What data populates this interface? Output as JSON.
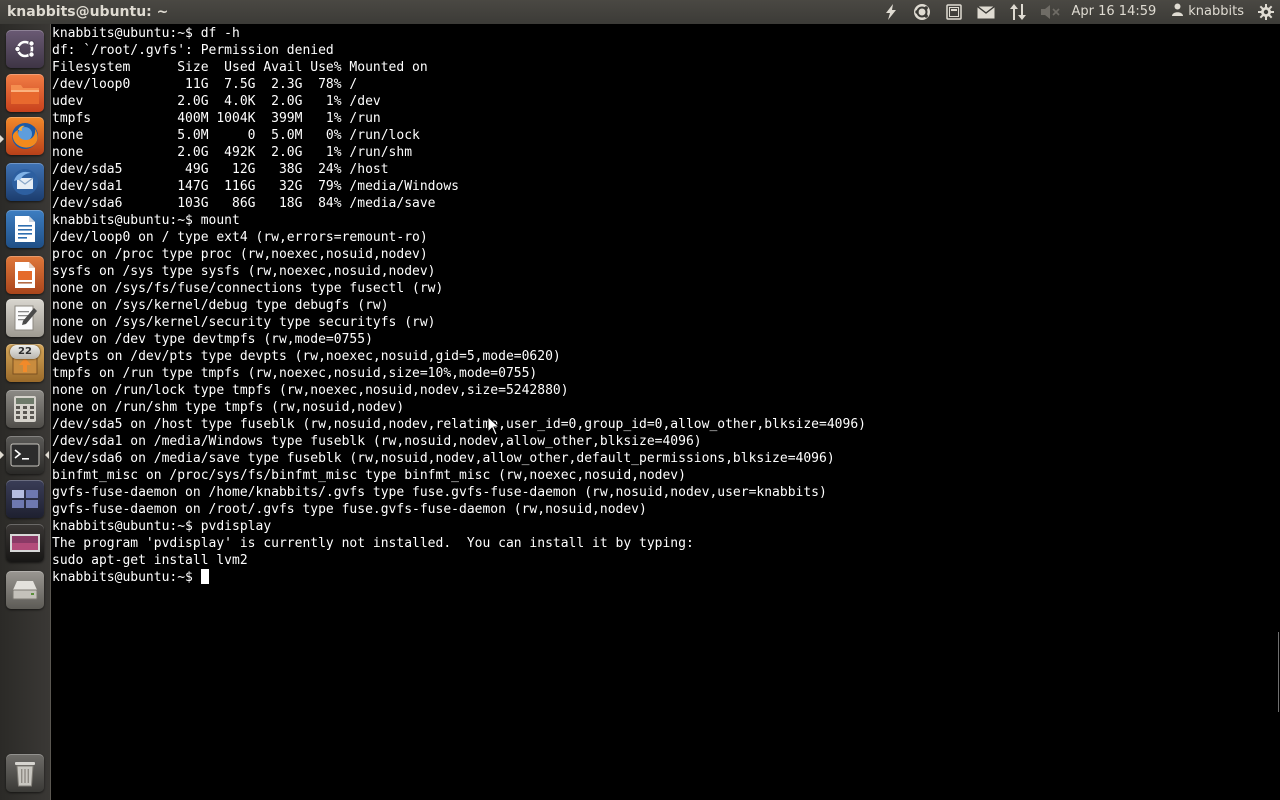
{
  "top_panel": {
    "title": "knabbits@ubuntu: ~",
    "clock": "Apr 16 14:59",
    "user": "knabbits",
    "indicators": [
      "lightning-icon",
      "ubuntu-one-icon",
      "battery-icon",
      "mail-icon",
      "network-icon",
      "sound-muted-icon",
      "user-icon",
      "gear-icon"
    ]
  },
  "launcher": {
    "items": [
      {
        "name": "dash-home",
        "icon": "ubuntu-logo-icon"
      },
      {
        "name": "files",
        "icon": "folder-icon"
      },
      {
        "name": "firefox",
        "icon": "firefox-icon"
      },
      {
        "name": "thunderbird",
        "icon": "thunderbird-icon"
      },
      {
        "name": "libreoffice-writer",
        "icon": "writer-icon"
      },
      {
        "name": "libreoffice-impress",
        "icon": "impress-icon"
      },
      {
        "name": "text-editor",
        "icon": "text-editor-icon"
      },
      {
        "name": "software-updater",
        "icon": "update-icon"
      },
      {
        "name": "calculator",
        "icon": "calculator-icon"
      },
      {
        "name": "terminal",
        "icon": "terminal-icon"
      },
      {
        "name": "workspace-switcher",
        "icon": "workspace-icon"
      },
      {
        "name": "screenshot",
        "icon": "screen-icon"
      },
      {
        "name": "disk",
        "icon": "drive-icon"
      },
      {
        "name": "trash",
        "icon": "trash-icon"
      }
    ],
    "update_count": "22"
  },
  "terminal": {
    "lines": [
      "knabbits@ubuntu:~$ df -h",
      "df: `/root/.gvfs': Permission denied",
      "Filesystem      Size  Used Avail Use% Mounted on",
      "/dev/loop0       11G  7.5G  2.3G  78% /",
      "udev            2.0G  4.0K  2.0G   1% /dev",
      "tmpfs           400M 1004K  399M   1% /run",
      "none            5.0M     0  5.0M   0% /run/lock",
      "none            2.0G  492K  2.0G   1% /run/shm",
      "/dev/sda5        49G   12G   38G  24% /host",
      "/dev/sda1       147G  116G   32G  79% /media/Windows",
      "/dev/sda6       103G   86G   18G  84% /media/save",
      "knabbits@ubuntu:~$ mount",
      "/dev/loop0 on / type ext4 (rw,errors=remount-ro)",
      "proc on /proc type proc (rw,noexec,nosuid,nodev)",
      "sysfs on /sys type sysfs (rw,noexec,nosuid,nodev)",
      "none on /sys/fs/fuse/connections type fusectl (rw)",
      "none on /sys/kernel/debug type debugfs (rw)",
      "none on /sys/kernel/security type securityfs (rw)",
      "udev on /dev type devtmpfs (rw,mode=0755)",
      "devpts on /dev/pts type devpts (rw,noexec,nosuid,gid=5,mode=0620)",
      "tmpfs on /run type tmpfs (rw,noexec,nosuid,size=10%,mode=0755)",
      "none on /run/lock type tmpfs (rw,noexec,nosuid,nodev,size=5242880)",
      "none on /run/shm type tmpfs (rw,nosuid,nodev)",
      "/dev/sda5 on /host type fuseblk (rw,nosuid,nodev,relatime,user_id=0,group_id=0,allow_other,blksize=4096)",
      "/dev/sda1 on /media/Windows type fuseblk (rw,nosuid,nodev,allow_other,blksize=4096)",
      "/dev/sda6 on /media/save type fuseblk (rw,nosuid,nodev,allow_other,default_permissions,blksize=4096)",
      "binfmt_misc on /proc/sys/fs/binfmt_misc type binfmt_misc (rw,noexec,nosuid,nodev)",
      "gvfs-fuse-daemon on /home/knabbits/.gvfs type fuse.gvfs-fuse-daemon (rw,nosuid,nodev,user=knabbits)",
      "gvfs-fuse-daemon on /root/.gvfs type fuse.gvfs-fuse-daemon (rw,nosuid,nodev)",
      "knabbits@ubuntu:~$ pvdisplay",
      "The program 'pvdisplay' is currently not installed.  You can install it by typing:",
      "sudo apt-get install lvm2"
    ],
    "prompt": "knabbits@ubuntu:~$ "
  },
  "colors": {
    "panel_bg": "#3c3b37",
    "panel_text": "#dfdbd2",
    "terminal_bg": "#000000",
    "terminal_fg": "#ffffff"
  }
}
